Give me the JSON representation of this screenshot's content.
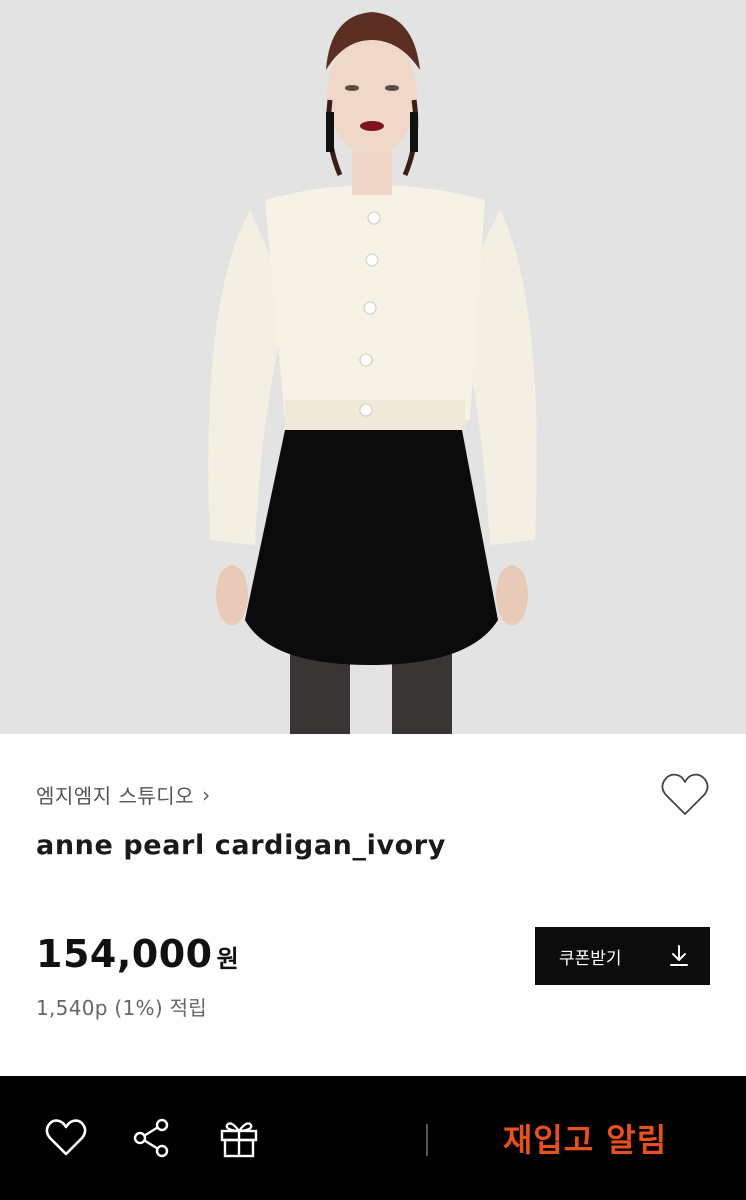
{
  "product_image": {
    "alt_icon": "product-photo"
  },
  "brand": {
    "name": "엠지엠지 스튜디오",
    "chevron": "›"
  },
  "product": {
    "name": "anne pearl cardigan_ivory",
    "price": "154,000",
    "currency": "원",
    "points": "1,540p (1%) 적립"
  },
  "coupon": {
    "label": "쿠폰받기",
    "icon": "download-icon"
  },
  "bottom_bar": {
    "icons": [
      "heart-icon",
      "share-icon",
      "gift-icon"
    ],
    "restock_label": "재입고 알림"
  },
  "colors": {
    "accent": "#e8501e",
    "bar": "#000000",
    "button": "#0c0c0c"
  }
}
